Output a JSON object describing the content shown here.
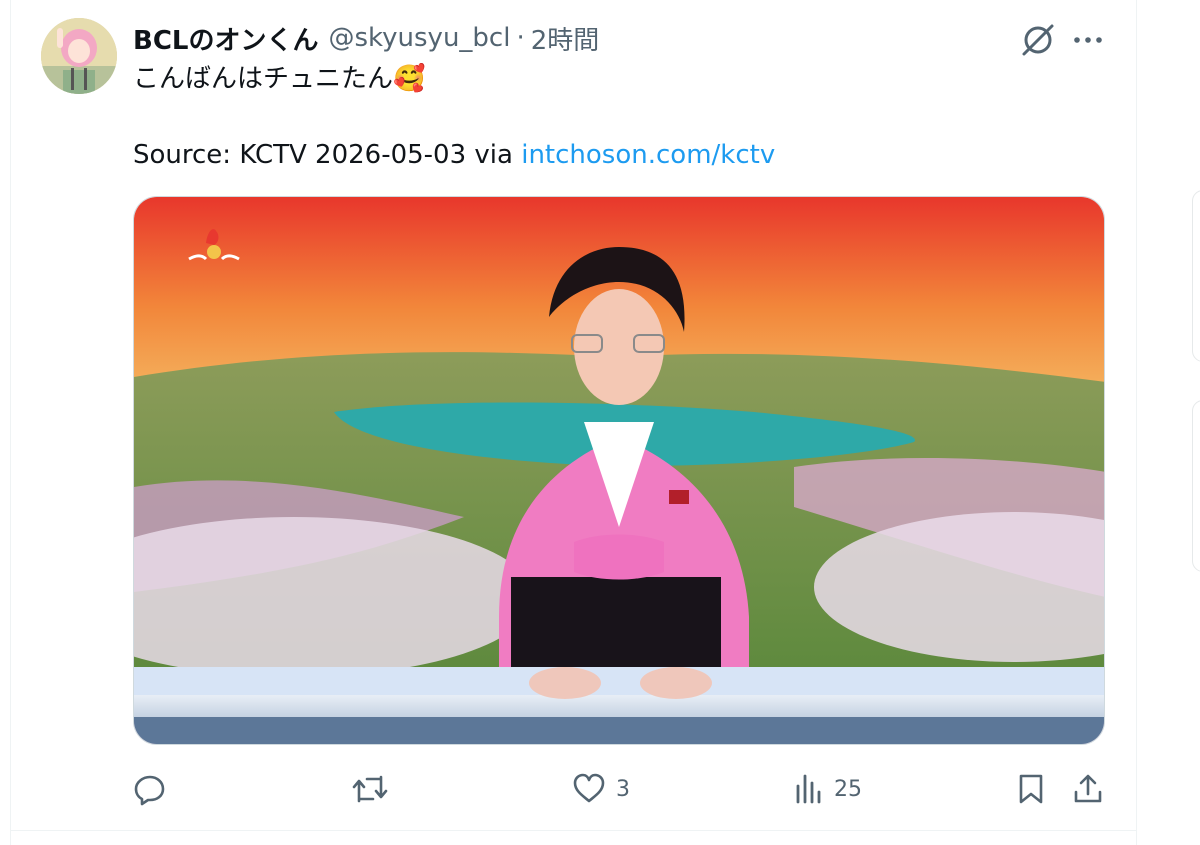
{
  "tweet": {
    "display_name": "BCLのオンくん",
    "handle": "@skyusyu_bcl",
    "separator": "·",
    "time": "2時間",
    "text": "こんばんはチュニたん🥰",
    "source_prefix": "Source: KCTV 2026-05-03 via ",
    "source_link": "intchoson.com/kctv"
  },
  "actions": {
    "reply_count": "",
    "retweet_count": "",
    "like_count": "3",
    "views_count": "25"
  },
  "icons": {
    "grok": "grok-icon",
    "more": "more-icon",
    "reply": "reply-icon",
    "retweet": "retweet-icon",
    "like": "heart-icon",
    "views": "views-icon",
    "bookmark": "bookmark-icon",
    "share": "share-icon"
  },
  "colors": {
    "text": "#0f1419",
    "secondary": "#536471",
    "link": "#1d9bf0",
    "border": "#cfd9de"
  }
}
